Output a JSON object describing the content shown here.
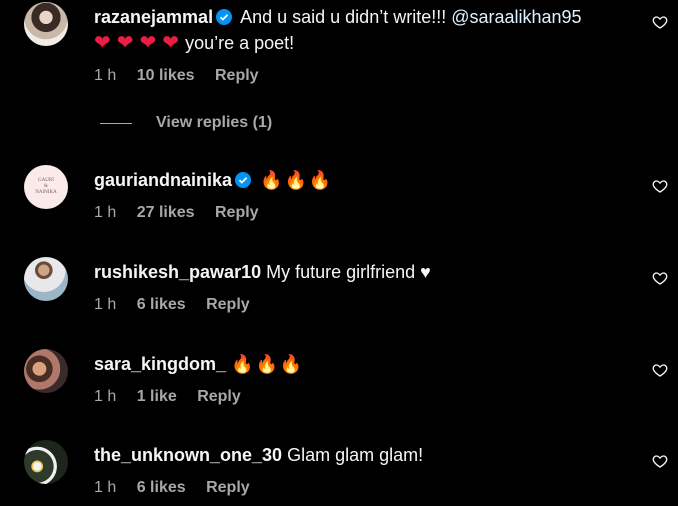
{
  "comments": [
    {
      "username": "razanejammal",
      "verified": true,
      "text_before_mention": "And u said u didn’t write!!! ",
      "mention": "@saraalikhan95",
      "hearts": [
        "❤",
        "❤",
        "❤",
        "❤"
      ],
      "text_after": "you’re a poet!",
      "time": "1 h",
      "likes": "10 likes",
      "reply": "Reply",
      "view_replies": "View replies (1)"
    },
    {
      "username": "gauriandnainika",
      "verified": true,
      "emojis": [
        "🔥",
        "🔥",
        "🔥"
      ],
      "avatar_lines": [
        "GAURI",
        "&",
        "NAINIKA"
      ],
      "time": "1 h",
      "likes": "27 likes",
      "reply": "Reply"
    },
    {
      "username": "rushikesh_pawar10",
      "text": "My future girlfriend ♥",
      "time": "1 h",
      "likes": "6 likes",
      "reply": "Reply"
    },
    {
      "username": "sara_kingdom_",
      "emojis": [
        "🔥",
        "🔥",
        "🔥"
      ],
      "time": "1 h",
      "likes": "1 like",
      "reply": "Reply"
    },
    {
      "username": "the_unknown_one_30",
      "text": "Glam glam glam!",
      "time": "1 h",
      "likes": "6 likes",
      "reply": "Reply"
    }
  ],
  "icons": {
    "like": "heart-outline-icon",
    "verified": "verified-badge-icon"
  },
  "colors": {
    "background": "#000000",
    "text": "#f5f5f5",
    "secondary": "#a8a8a8",
    "verified": "#0095f6",
    "heart": "#ed1c45"
  }
}
